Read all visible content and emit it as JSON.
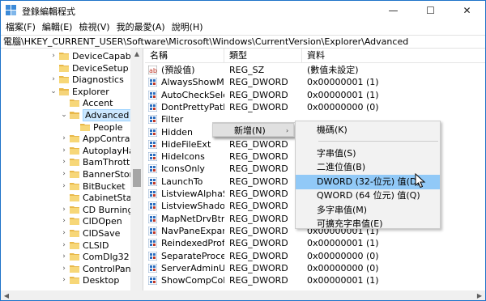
{
  "window": {
    "title": "登錄編輯程式",
    "controls": {
      "minimize": "—",
      "maximize": "☐",
      "close": "✕"
    }
  },
  "menubar": {
    "items": [
      "檔案(F)",
      "編輯(E)",
      "檢視(V)",
      "我的最愛(A)",
      "說明(H)"
    ]
  },
  "address": "電腦\\HKEY_CURRENT_USER\\Software\\Microsoft\\Windows\\CurrentVersion\\Explorer\\Advanced",
  "tree": {
    "items": [
      {
        "label": "DeviceCapabilit",
        "level": 1,
        "expander": "collapsed"
      },
      {
        "label": "DeviceSetup",
        "level": 1,
        "expander": "none"
      },
      {
        "label": "Diagnostics",
        "level": 1,
        "expander": "collapsed"
      },
      {
        "label": "Explorer",
        "level": 1,
        "expander": "expanded"
      },
      {
        "label": "Accent",
        "level": 2,
        "expander": "none"
      },
      {
        "label": "Advanced",
        "level": 2,
        "expander": "expanded",
        "selected": true
      },
      {
        "label": "People",
        "level": 3,
        "expander": "none"
      },
      {
        "label": "AppContract",
        "level": 2,
        "expander": "collapsed"
      },
      {
        "label": "AutoplayHan",
        "level": 2,
        "expander": "collapsed"
      },
      {
        "label": "BamThrottlin",
        "level": 2,
        "expander": "collapsed"
      },
      {
        "label": "BannerStore",
        "level": 2,
        "expander": "collapsed"
      },
      {
        "label": "BitBucket",
        "level": 2,
        "expander": "collapsed"
      },
      {
        "label": "CabinetState",
        "level": 2,
        "expander": "none"
      },
      {
        "label": "CD Burning",
        "level": 2,
        "expander": "collapsed"
      },
      {
        "label": "CIDOpen",
        "level": 2,
        "expander": "collapsed"
      },
      {
        "label": "CIDSave",
        "level": 2,
        "expander": "collapsed"
      },
      {
        "label": "CLSID",
        "level": 2,
        "expander": "collapsed"
      },
      {
        "label": "ComDlg32",
        "level": 2,
        "expander": "collapsed"
      },
      {
        "label": "ControlPanel",
        "level": 2,
        "expander": "collapsed"
      },
      {
        "label": "Desktop",
        "level": 2,
        "expander": "collapsed"
      }
    ]
  },
  "list": {
    "columns": {
      "name": "名稱",
      "type": "類型",
      "data": "資料"
    },
    "rows": [
      {
        "icon": "string",
        "name": "(預設值)",
        "type": "REG_SZ",
        "data": "(數值未設定)"
      },
      {
        "icon": "binary",
        "name": "AlwaysShowM...",
        "type": "REG_DWORD",
        "data": "0x00000001 (1)"
      },
      {
        "icon": "binary",
        "name": "AutoCheckSelect",
        "type": "REG_DWORD",
        "data": "0x00000001 (1)"
      },
      {
        "icon": "binary",
        "name": "DontPrettyPath",
        "type": "REG_DWORD",
        "data": "0x00000000 (0)"
      },
      {
        "icon": "binary",
        "name": "Filter",
        "type": "",
        "data": ""
      },
      {
        "icon": "binary",
        "name": "Hidden",
        "type": "",
        "data": ""
      },
      {
        "icon": "binary",
        "name": "HideFileExt",
        "type": "REG_DWORD",
        "data": ""
      },
      {
        "icon": "binary",
        "name": "HideIcons",
        "type": "REG_DWORD",
        "data": ""
      },
      {
        "icon": "binary",
        "name": "IconsOnly",
        "type": "REG_DWORD",
        "data": ""
      },
      {
        "icon": "binary",
        "name": "LaunchTo",
        "type": "REG_DWORD",
        "data": ""
      },
      {
        "icon": "binary",
        "name": "ListviewAlphaS...",
        "type": "REG_DWORD",
        "data": ""
      },
      {
        "icon": "binary",
        "name": "ListviewShadow",
        "type": "REG_DWORD",
        "data": ""
      },
      {
        "icon": "binary",
        "name": "MapNetDrvBtn",
        "type": "REG_DWORD",
        "data": ""
      },
      {
        "icon": "binary",
        "name": "NavPaneExpan...",
        "type": "REG_DWORD",
        "data": "0x00000001 (1)"
      },
      {
        "icon": "binary",
        "name": "ReindexedProfi...",
        "type": "REG_DWORD",
        "data": "0x00000001 (1)"
      },
      {
        "icon": "binary",
        "name": "SeparateProcess",
        "type": "REG_DWORD",
        "data": "0x00000000 (0)"
      },
      {
        "icon": "binary",
        "name": "ServerAdminUI",
        "type": "REG_DWORD",
        "data": "0x00000000 (0)"
      },
      {
        "icon": "binary",
        "name": "ShowCompCol...",
        "type": "REG_DWORD",
        "data": "0x00000001 (1)"
      }
    ]
  },
  "context_menu": {
    "new_label": "新增(N)",
    "new_arrow": "›",
    "submenu": [
      {
        "label": "機碼(K)",
        "group": 1
      },
      {
        "label": "字串值(S)",
        "group": 2
      },
      {
        "label": "二進位值(B)",
        "group": 2
      },
      {
        "label": "DWORD (32-位元) 值(D)",
        "group": 2,
        "highlighted": true
      },
      {
        "label": "QWORD (64 位元) 值(Q)",
        "group": 2
      },
      {
        "label": "多字串值(M)",
        "group": 2
      },
      {
        "label": "可擴充字串值(E)",
        "group": 2
      }
    ]
  },
  "colors": {
    "selection": "#cce8ff",
    "menu_highlight": "#91c9f7",
    "folder": "#e8b84a",
    "reg_sz_icon": "#c0392b",
    "reg_dword_icon": "#2e6fbf"
  }
}
